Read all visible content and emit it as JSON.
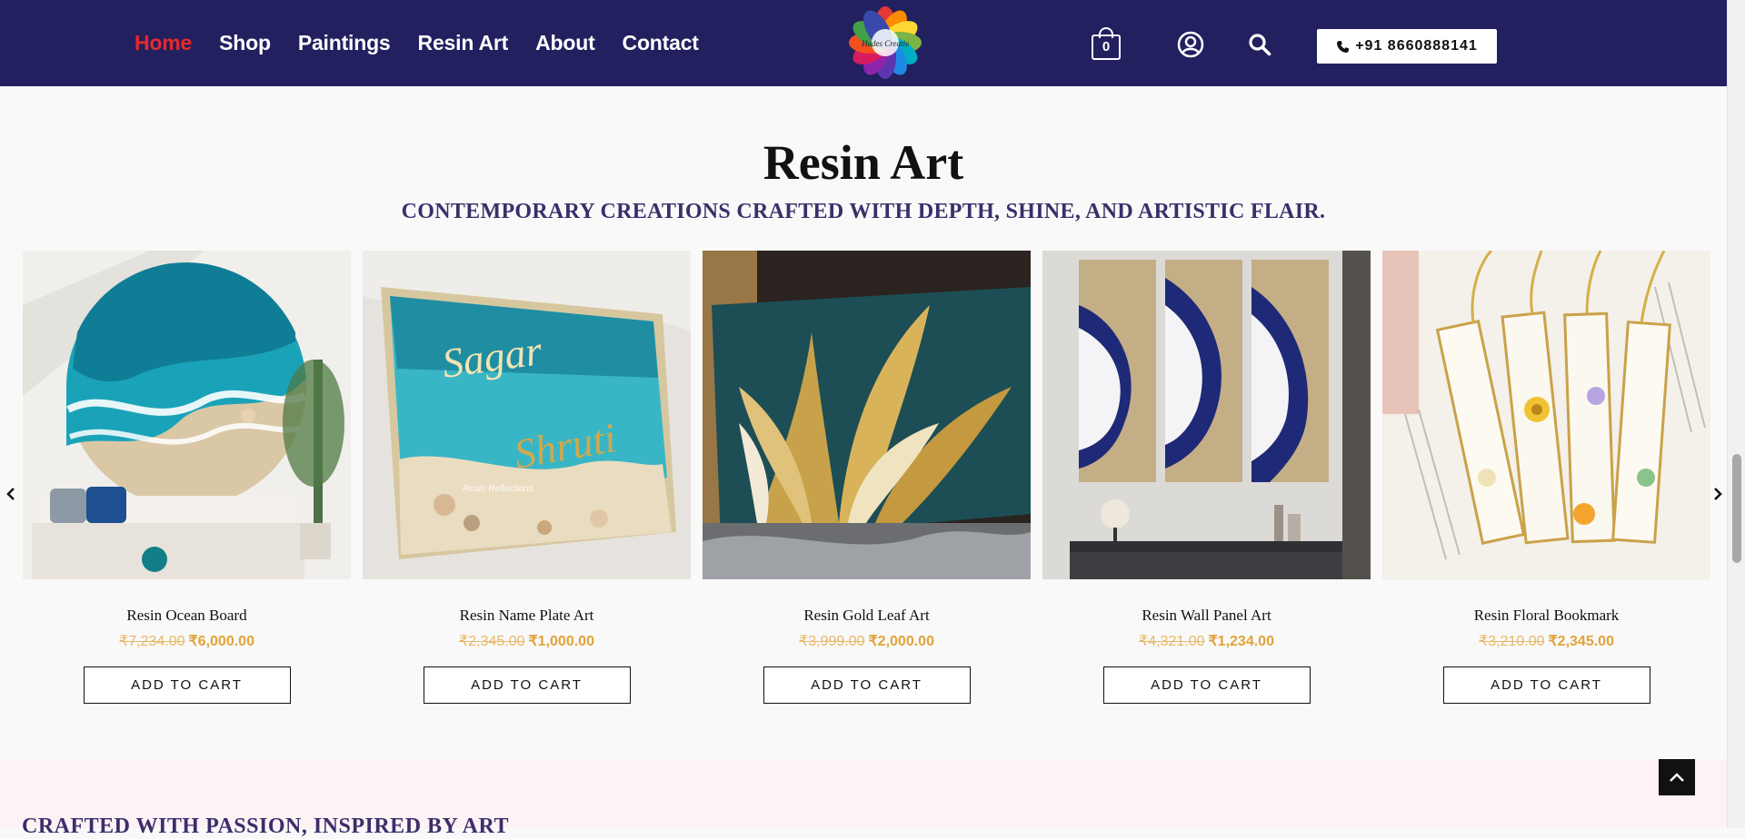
{
  "header": {
    "nav": [
      "Home",
      "Shop",
      "Paintings",
      "Resin Art",
      "About",
      "Contact"
    ],
    "active_nav": "Home",
    "logo_text": "Hades Creativ",
    "cart_count": "0",
    "phone": "+91 8660888141",
    "colors": {
      "background": "#22205f",
      "active": "#e8282c",
      "price": "#e1a33a"
    }
  },
  "section": {
    "title": "Resin Art",
    "subtitle": "CONTEMPORARY CREATIONS CRAFTED WITH DEPTH, SHINE, AND ARTISTIC FLAIR."
  },
  "products": [
    {
      "name": "Resin Ocean Board",
      "old_price": "₹7,234.00",
      "price": "₹6,000.00",
      "button": "ADD TO CART",
      "image": "ocean-resin-wall-art"
    },
    {
      "name": "Resin Name Plate Art",
      "old_price": "₹2,345.00",
      "price": "₹1,000.00",
      "button": "ADD TO CART",
      "image": "resin-name-plate",
      "image_text_1": "Sagar",
      "image_text_2": "Shruti",
      "image_watermark": "Resin Reflections"
    },
    {
      "name": "Resin Gold Leaf Art",
      "old_price": "₹3,999.00",
      "price": "₹2,000.00",
      "button": "ADD TO CART",
      "image": "gold-leaf-resin-art"
    },
    {
      "name": "Resin Wall Panel Art",
      "old_price": "₹4,321.00",
      "price": "₹1,234.00",
      "button": "ADD TO CART",
      "image": "geode-wall-panels"
    },
    {
      "name": "Resin Floral Bookmark",
      "old_price": "₹3,210.00",
      "price": "₹2,345.00",
      "button": "ADD TO CART",
      "image": "floral-bookmarks"
    }
  ],
  "bottom": {
    "heading": "CRAFTED WITH PASSION, INSPIRED BY ART"
  }
}
